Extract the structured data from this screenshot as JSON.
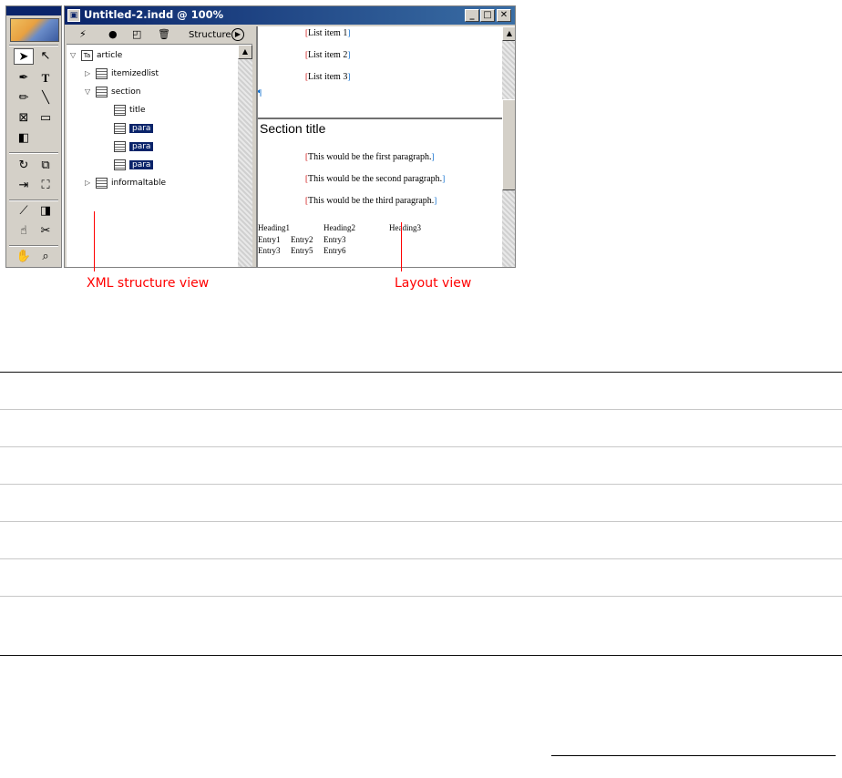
{
  "window": {
    "title": "Untitled-2.indd @ 100%",
    "minimize": "_",
    "maximize": "□",
    "close": "✕"
  },
  "structure_pane": {
    "toolbar_label": "Structure",
    "toolbar_icons": [
      "lightning-icon",
      "dot-icon",
      "frame-icon",
      "trash-icon"
    ],
    "tree": [
      {
        "label": "article",
        "depth": 0,
        "expanded": true,
        "selected": false
      },
      {
        "label": "itemizedlist",
        "depth": 1,
        "expanded": false,
        "selected": false
      },
      {
        "label": "section",
        "depth": 1,
        "expanded": true,
        "selected": false
      },
      {
        "label": "title",
        "depth": 2,
        "selected": false
      },
      {
        "label": "para",
        "depth": 2,
        "selected": true
      },
      {
        "label": "para",
        "depth": 2,
        "selected": true
      },
      {
        "label": "para",
        "depth": 2,
        "selected": true
      },
      {
        "label": "informaltable",
        "depth": 1,
        "expanded": false,
        "selected": false
      }
    ]
  },
  "layout_pane": {
    "list_items": [
      "List item 1",
      "List item 2",
      "List item 3"
    ],
    "section_title": "Section title",
    "paragraphs": [
      "This would be the first paragraph.",
      "This would be the second paragraph.",
      "This would be the third paragraph."
    ],
    "table_headings": [
      "Heading1",
      "Heading2",
      "Heading3"
    ],
    "table_row1": [
      "Entry1",
      "Entry2",
      "Entry3"
    ],
    "table_row2": [
      "Entry3",
      "Entry5",
      "Entry6"
    ]
  },
  "callouts": {
    "xml_structure": "XML structure view",
    "layout": "Layout view"
  },
  "colors": {
    "callout": "#ff0000",
    "titlebar": "#0a246a",
    "selection": "#0a246a"
  }
}
